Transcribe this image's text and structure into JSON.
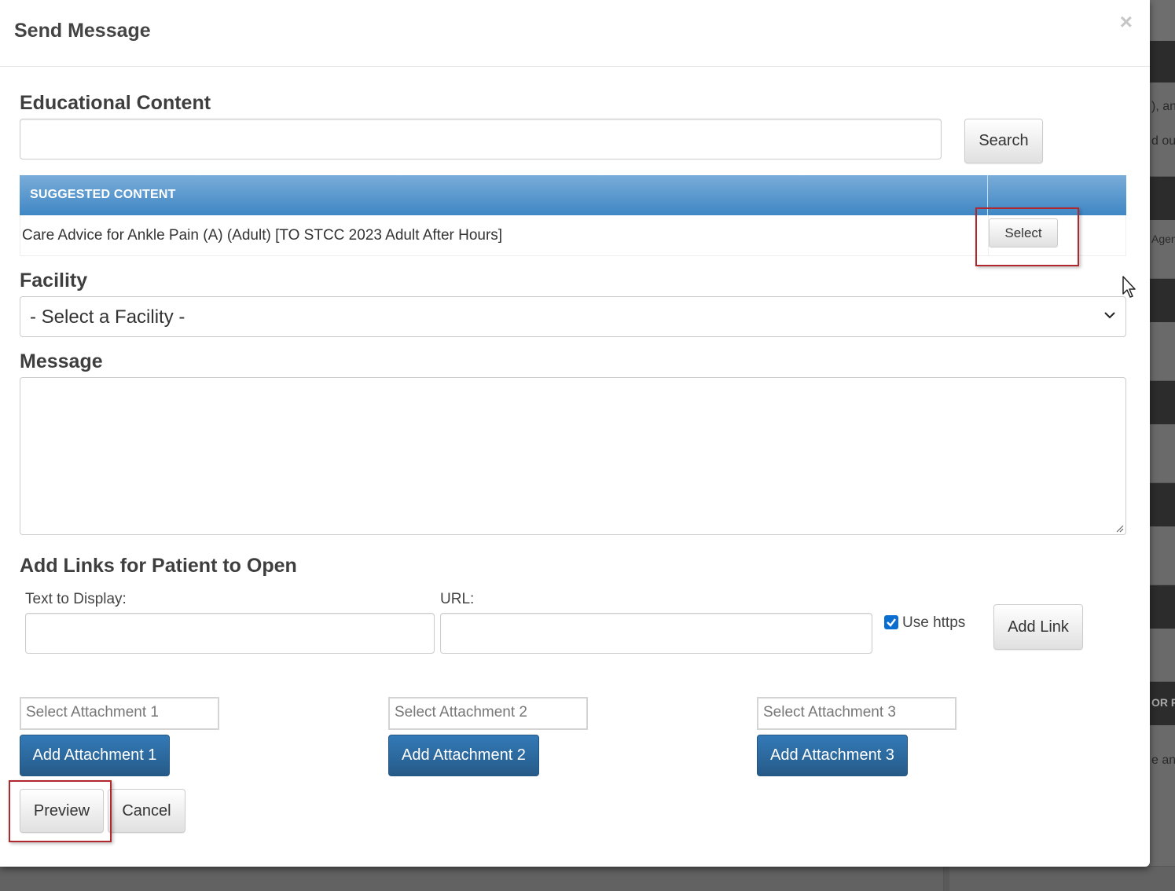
{
  "modal": {
    "title": "Send Message",
    "close_label": "×"
  },
  "educational_content": {
    "label": "Educational Content",
    "search_value": "",
    "search_button": "Search",
    "table_header": "SUGGESTED CONTENT",
    "rows": [
      {
        "title": "Care Advice for Ankle Pain (A) (Adult) [TO STCC 2023 Adult After Hours]",
        "action": "Select"
      }
    ]
  },
  "facility": {
    "label": "Facility",
    "selected": "- Select a Facility -"
  },
  "message": {
    "label": "Message",
    "value": ""
  },
  "links": {
    "label": "Add Links for Patient to Open",
    "text_label": "Text to Display:",
    "url_label": "URL:",
    "https_label": "Use https",
    "https_checked": true,
    "add_button": "Add Link"
  },
  "attachments": [
    {
      "placeholder": "Select Attachment 1",
      "button": "Add Attachment 1"
    },
    {
      "placeholder": "Select Attachment 2",
      "button": "Add Attachment 2"
    },
    {
      "placeholder": "Select Attachment 3",
      "button": "Add Attachment 3"
    }
  ],
  "footer": {
    "preview_button": "Preview",
    "cancel_button": "Cancel"
  },
  "background_fragments": [
    "), an",
    "d out",
    "Agen",
    "OR PA",
    "e an"
  ],
  "colors": {
    "primary": "#337ab7",
    "table_header": "#4a8ec9",
    "highlight": "#b0282d",
    "checkbox": "#0a6ed1"
  }
}
